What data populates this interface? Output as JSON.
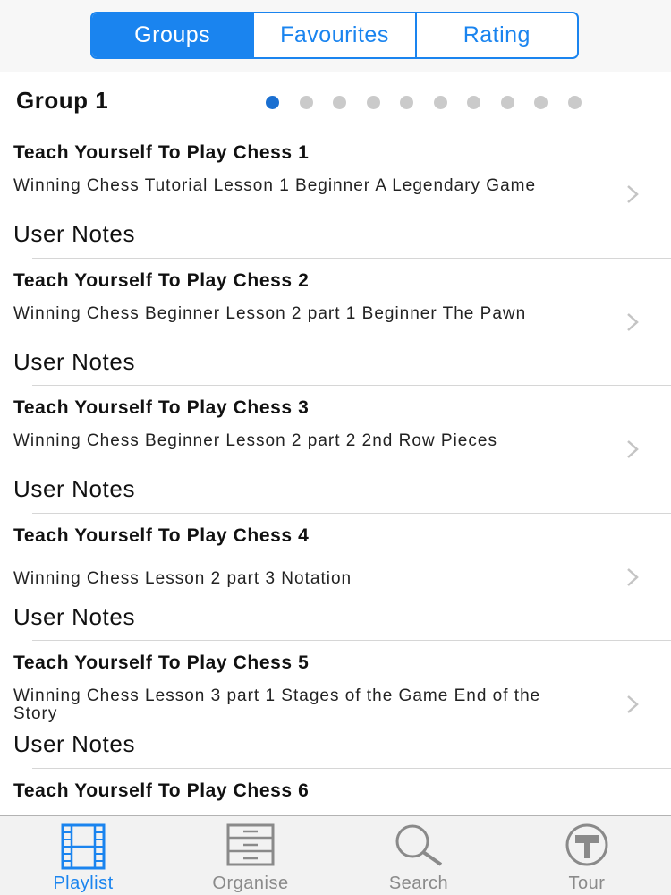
{
  "segments": [
    {
      "label": "Groups",
      "active": true
    },
    {
      "label": "Favourites",
      "active": false
    },
    {
      "label": "Rating",
      "active": false
    }
  ],
  "group": {
    "title": "Group 1",
    "page_count": 10,
    "active_page": 1
  },
  "rows": [
    {
      "title": "Teach Yourself To Play Chess 1",
      "description": "Winning Chess  Tutorial  Lesson 1  Beginner  A Legendary Game",
      "notes": "User Notes"
    },
    {
      "title": "Teach Yourself To Play Chess 2",
      "description": "Winning Chess  Beginner  Lesson 2 part 1  Beginner The Pawn",
      "notes": "User Notes"
    },
    {
      "title": "Teach Yourself To Play Chess 3",
      "description": "Winning Chess  Beginner  Lesson 2 part 2  2nd Row Pieces",
      "notes": "User Notes"
    },
    {
      "title": "Teach Yourself To Play Chess 4",
      "description": "Winning Chess  Lesson 2 part 3  Notation",
      "notes": "User Notes"
    },
    {
      "title": "Teach Yourself To Play Chess 5",
      "description": "Winning Chess  Lesson 3 part 1  Stages of the Game End of the Story",
      "notes": "User Notes"
    },
    {
      "title": "Teach Yourself To Play Chess 6",
      "description": "",
      "notes": ""
    }
  ],
  "tabs": [
    {
      "label": "Playlist",
      "icon": "film-strip-icon",
      "active": true
    },
    {
      "label": "Organise",
      "icon": "organise-icon",
      "active": false
    },
    {
      "label": "Search",
      "icon": "search-icon",
      "active": false
    },
    {
      "label": "Tour",
      "icon": "tour-icon",
      "active": false
    }
  ],
  "colors": {
    "accent": "#1a84ef",
    "dot_active": "#1a6fd1",
    "dot_inactive": "#cacaca",
    "tab_inactive": "#8a8a8a"
  }
}
